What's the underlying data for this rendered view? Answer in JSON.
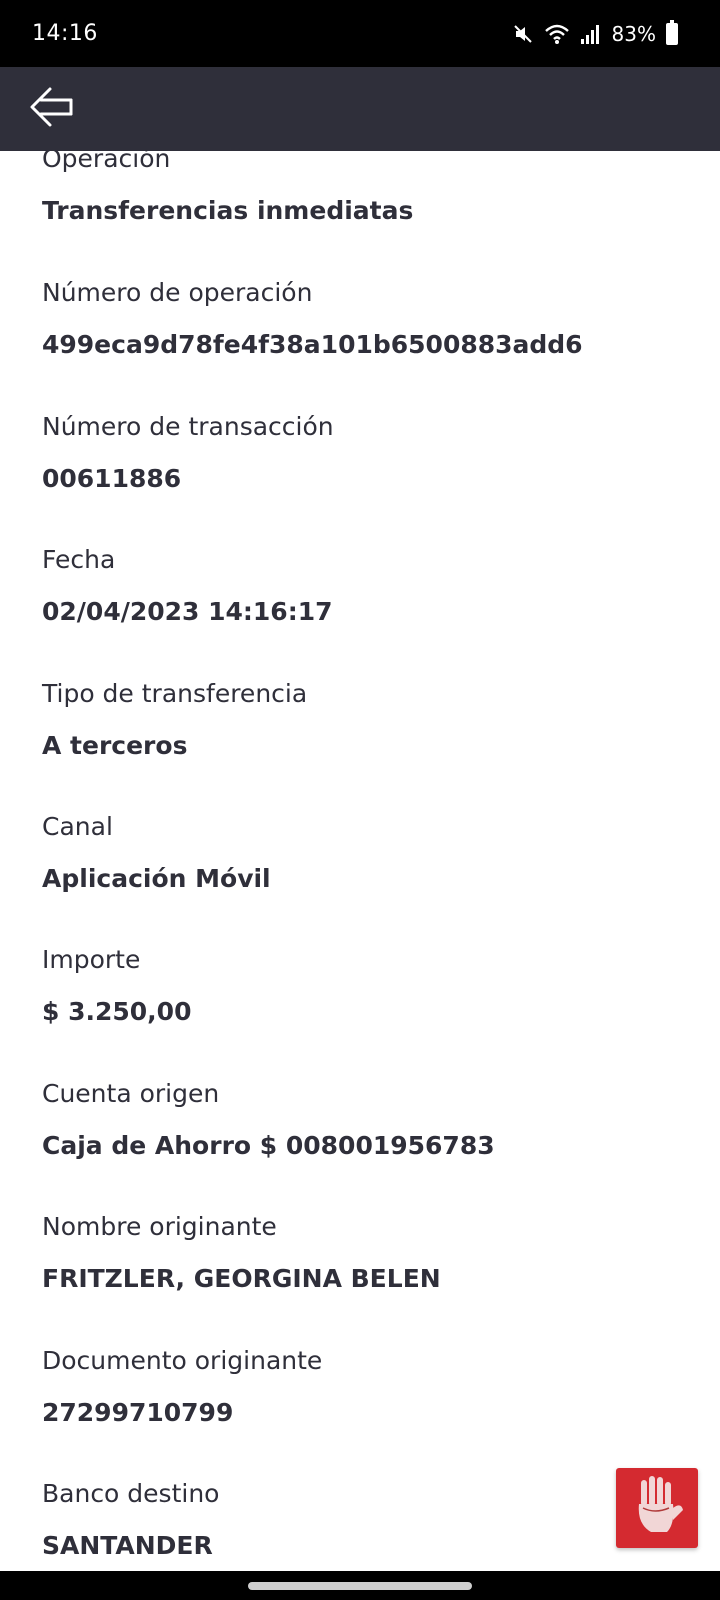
{
  "status_bar": {
    "time": "14:16",
    "battery": "83%",
    "icons": [
      "mute-icon",
      "wifi-icon",
      "signal-icon",
      "battery-icon"
    ]
  },
  "app_bar": {
    "back_icon": "back-arrow-icon"
  },
  "fields": [
    {
      "label": "Operación",
      "value": "Transferencias inmediatas"
    },
    {
      "label": "Número de operación",
      "value": "499eca9d78fe4f38a101b6500883add6"
    },
    {
      "label": "Número de transacción",
      "value": "00611886"
    },
    {
      "label": "Fecha",
      "value": "02/04/2023 14:16:17"
    },
    {
      "label": "Tipo de transferencia",
      "value": "A terceros"
    },
    {
      "label": "Canal",
      "value": "Aplicación Móvil"
    },
    {
      "label": "Importe",
      "value": "$ 3.250,00"
    },
    {
      "label": "Cuenta origen",
      "value": "Caja de Ahorro $ 008001956783"
    },
    {
      "label": "Nombre originante",
      "value": "FRITZLER, GEORGINA BELEN"
    },
    {
      "label": "Documento originante",
      "value": "27299710799"
    },
    {
      "label": "Banco destino",
      "value": "SANTANDER"
    }
  ],
  "fab": {
    "icon": "hand-icon",
    "color": "#d42a30"
  },
  "colors": {
    "app_bar": "#2f2f3a",
    "text": "#2f2f3a"
  }
}
